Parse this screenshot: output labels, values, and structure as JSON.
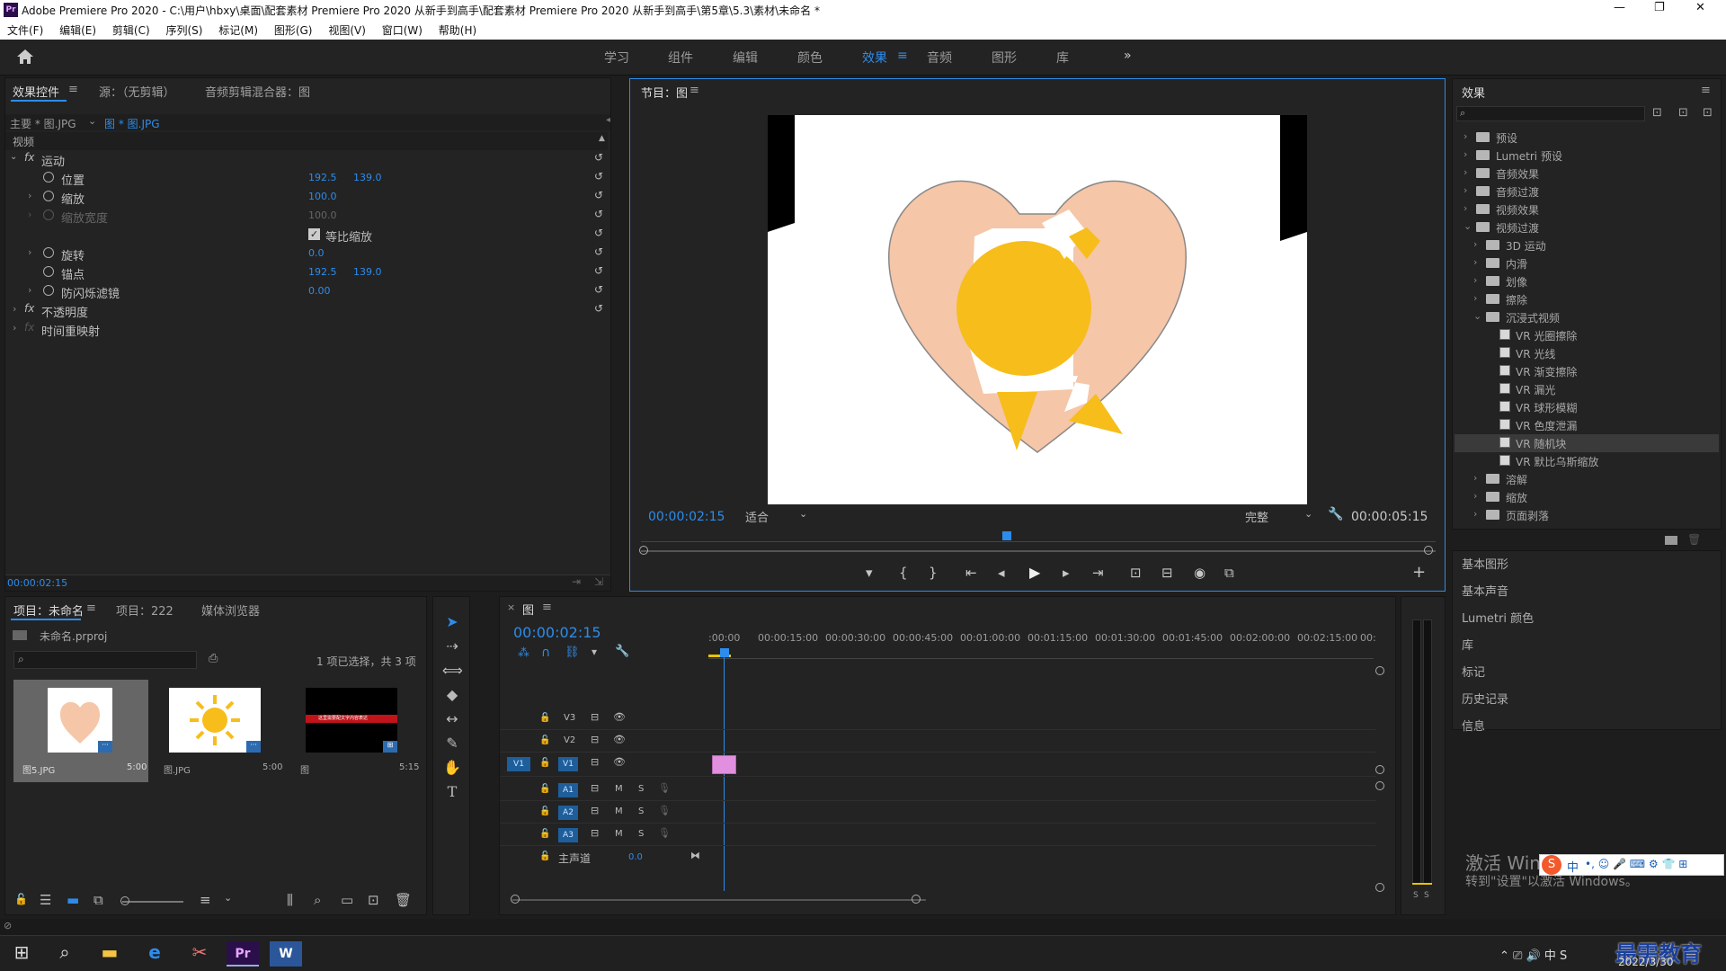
{
  "window": {
    "title": "Adobe Premiere Pro 2020 - C:\\用户\\hbxy\\桌面\\配套素材 Premiere Pro 2020 从新手到高手\\配套素材 Premiere Pro 2020 从新手到高手\\第5章\\5.3\\素材\\未命名 *",
    "minimize": "—",
    "maximize": "❐",
    "close": "✕"
  },
  "menu": [
    "文件(F)",
    "编辑(E)",
    "剪辑(C)",
    "序列(S)",
    "标记(M)",
    "图形(G)",
    "视图(V)",
    "窗口(W)",
    "帮助(H)"
  ],
  "workspaces": {
    "items": [
      "学习",
      "组件",
      "编辑",
      "颜色",
      "效果",
      "音频",
      "图形",
      "库"
    ],
    "active": "效果",
    "menu_icon": "≡",
    "more": "»"
  },
  "effect_controls": {
    "tabs": [
      "效果控件",
      "源：（无剪辑）",
      "音频剪辑混合器：图"
    ],
    "tab_menu": "≡",
    "master_clip": "主要 * 图.JPG",
    "seq_clip": "图 * 图.JPG",
    "section_video": "视频",
    "motion": "运动",
    "properties": [
      {
        "label": "位置",
        "v1": "192.5",
        "v2": "139.0"
      },
      {
        "label": "缩放",
        "v1": "100.0",
        "v2": ""
      },
      {
        "label": "缩放宽度",
        "v1": "100.0",
        "v2": ""
      },
      {
        "label": "等比缩放",
        "v1": "",
        "v2": ""
      },
      {
        "label": "旋转",
        "v1": "0.0",
        "v2": ""
      },
      {
        "label": "锚点",
        "v1": "192.5",
        "v2": "139.0"
      },
      {
        "label": "防闪烁滤镜",
        "v1": "0.00",
        "v2": ""
      }
    ],
    "opacity": "不透明度",
    "time_remap": "时间重映射",
    "timecode": "00:00:02:15"
  },
  "program": {
    "tab": "节目：图",
    "timecode": "00:00:02:15",
    "fit": "适合",
    "quality": "完整",
    "duration": "00:00:05:15",
    "controls": [
      "▾",
      "{",
      "}",
      "⇤",
      "◂",
      "▶",
      "▸",
      "⇥",
      "⊡",
      "⊟",
      "◉",
      "⧉",
      "+"
    ]
  },
  "project": {
    "tabs": [
      "项目：未命名",
      "项目：222",
      "媒体浏览器"
    ],
    "file": "未命名.prproj",
    "selection": "1 项已选择，共 3 项",
    "items": [
      {
        "name": "图5.JPG",
        "dur": "5:00"
      },
      {
        "name": "图.JPG",
        "dur": "5:00"
      },
      {
        "name": "图",
        "dur": "5:15"
      }
    ],
    "thumb_caption": "这里需要配文字内容表达"
  },
  "timeline": {
    "tab": "图",
    "timecode": "00:00:02:15",
    "ruler": [
      ":00:00",
      "00:00:15:00",
      "00:00:30:00",
      "00:00:45:00",
      "00:01:00:00",
      "00:01:15:00",
      "00:01:30:00",
      "00:01:45:00",
      "00:02:00:00",
      "00:02:15:00",
      "00:"
    ],
    "video_tracks": [
      "V3",
      "V2",
      "V1"
    ],
    "audio_tracks": [
      "A1",
      "A2",
      "A3"
    ],
    "master": "主声道",
    "master_val": "0.0",
    "src_patch": "V1",
    "mute": "M",
    "solo": "S"
  },
  "effects_panel": {
    "title": "效果",
    "menu": "≡",
    "tree": [
      {
        "label": "预设",
        "level": 0,
        "open": false
      },
      {
        "label": "Lumetri 预设",
        "level": 0,
        "open": false
      },
      {
        "label": "音频效果",
        "level": 0,
        "open": false
      },
      {
        "label": "音频过渡",
        "level": 0,
        "open": false
      },
      {
        "label": "视频效果",
        "level": 0,
        "open": false
      },
      {
        "label": "视频过渡",
        "level": 0,
        "open": true
      },
      {
        "label": "3D 运动",
        "level": 1,
        "open": false
      },
      {
        "label": "内滑",
        "level": 1,
        "open": false
      },
      {
        "label": "划像",
        "level": 1,
        "open": false
      },
      {
        "label": "擦除",
        "level": 1,
        "open": false
      },
      {
        "label": "沉浸式视频",
        "level": 1,
        "open": true
      },
      {
        "label": "VR 光圈擦除",
        "level": 2
      },
      {
        "label": "VR 光线",
        "level": 2
      },
      {
        "label": "VR 渐变擦除",
        "level": 2
      },
      {
        "label": "VR 漏光",
        "level": 2
      },
      {
        "label": "VR 球形模糊",
        "level": 2
      },
      {
        "label": "VR 色度泄漏",
        "level": 2
      },
      {
        "label": "VR 随机块",
        "level": 2,
        "selected": true
      },
      {
        "label": "VR 默比乌斯缩放",
        "level": 2
      },
      {
        "label": "溶解",
        "level": 1,
        "open": false
      },
      {
        "label": "缩放",
        "level": 1,
        "open": false
      },
      {
        "label": "页面剥落",
        "level": 1,
        "open": false
      }
    ],
    "sections": [
      "基本图形",
      "基本声音",
      "Lumetri 颜色",
      "库",
      "标记",
      "历史记录",
      "信息"
    ]
  },
  "activation": {
    "line1": "激活 Win",
    "line2": "转到\"设置\"以激活 Windows。"
  },
  "taskbar": {
    "date": "2022/3/30",
    "ime": "中",
    "watermark": "最需教育"
  },
  "colors": {
    "accent": "#2d8ceb",
    "heart": "#f5c6a8",
    "sun": "#f7bd1a",
    "clip": "#e38fe0"
  }
}
